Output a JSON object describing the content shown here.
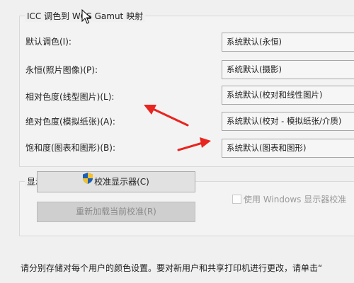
{
  "gamut_group": {
    "title": "ICC 调色到 WCS Gamut 映射",
    "rows": [
      {
        "label": "默认调色(I):",
        "value": "系统默认(永恒)"
      },
      {
        "label": "永恒(照片图像)(P):",
        "value": "系统默认(摄影)"
      },
      {
        "label": "相对色度(线型图片)(L):",
        "value": "系统默认(校对和线性图片)"
      },
      {
        "label": "绝对色度(模拟纸张)(A):",
        "value": "系统默认(校对 - 模拟纸张/介质)"
      },
      {
        "label": "饱和度(图表和图形)(B):",
        "value": "系统默认(图表和图形)"
      }
    ]
  },
  "calibration_group": {
    "title": "显示器校准",
    "calibrate_button": "校准显示器(C)",
    "reload_button": "重新加载当前校准(R)",
    "windows_calibration_checkbox": "使用 Windows 显示器校准",
    "windows_calibration_checked": false
  },
  "footer_text": "请分别存储对每个用户的颜色设置。要对新用户和共享打印机进行更改，请单击“",
  "annotation_arrow_color": "#e8251f",
  "shield_icon_colors": [
    "#1b5fb4",
    "#f2c230"
  ]
}
